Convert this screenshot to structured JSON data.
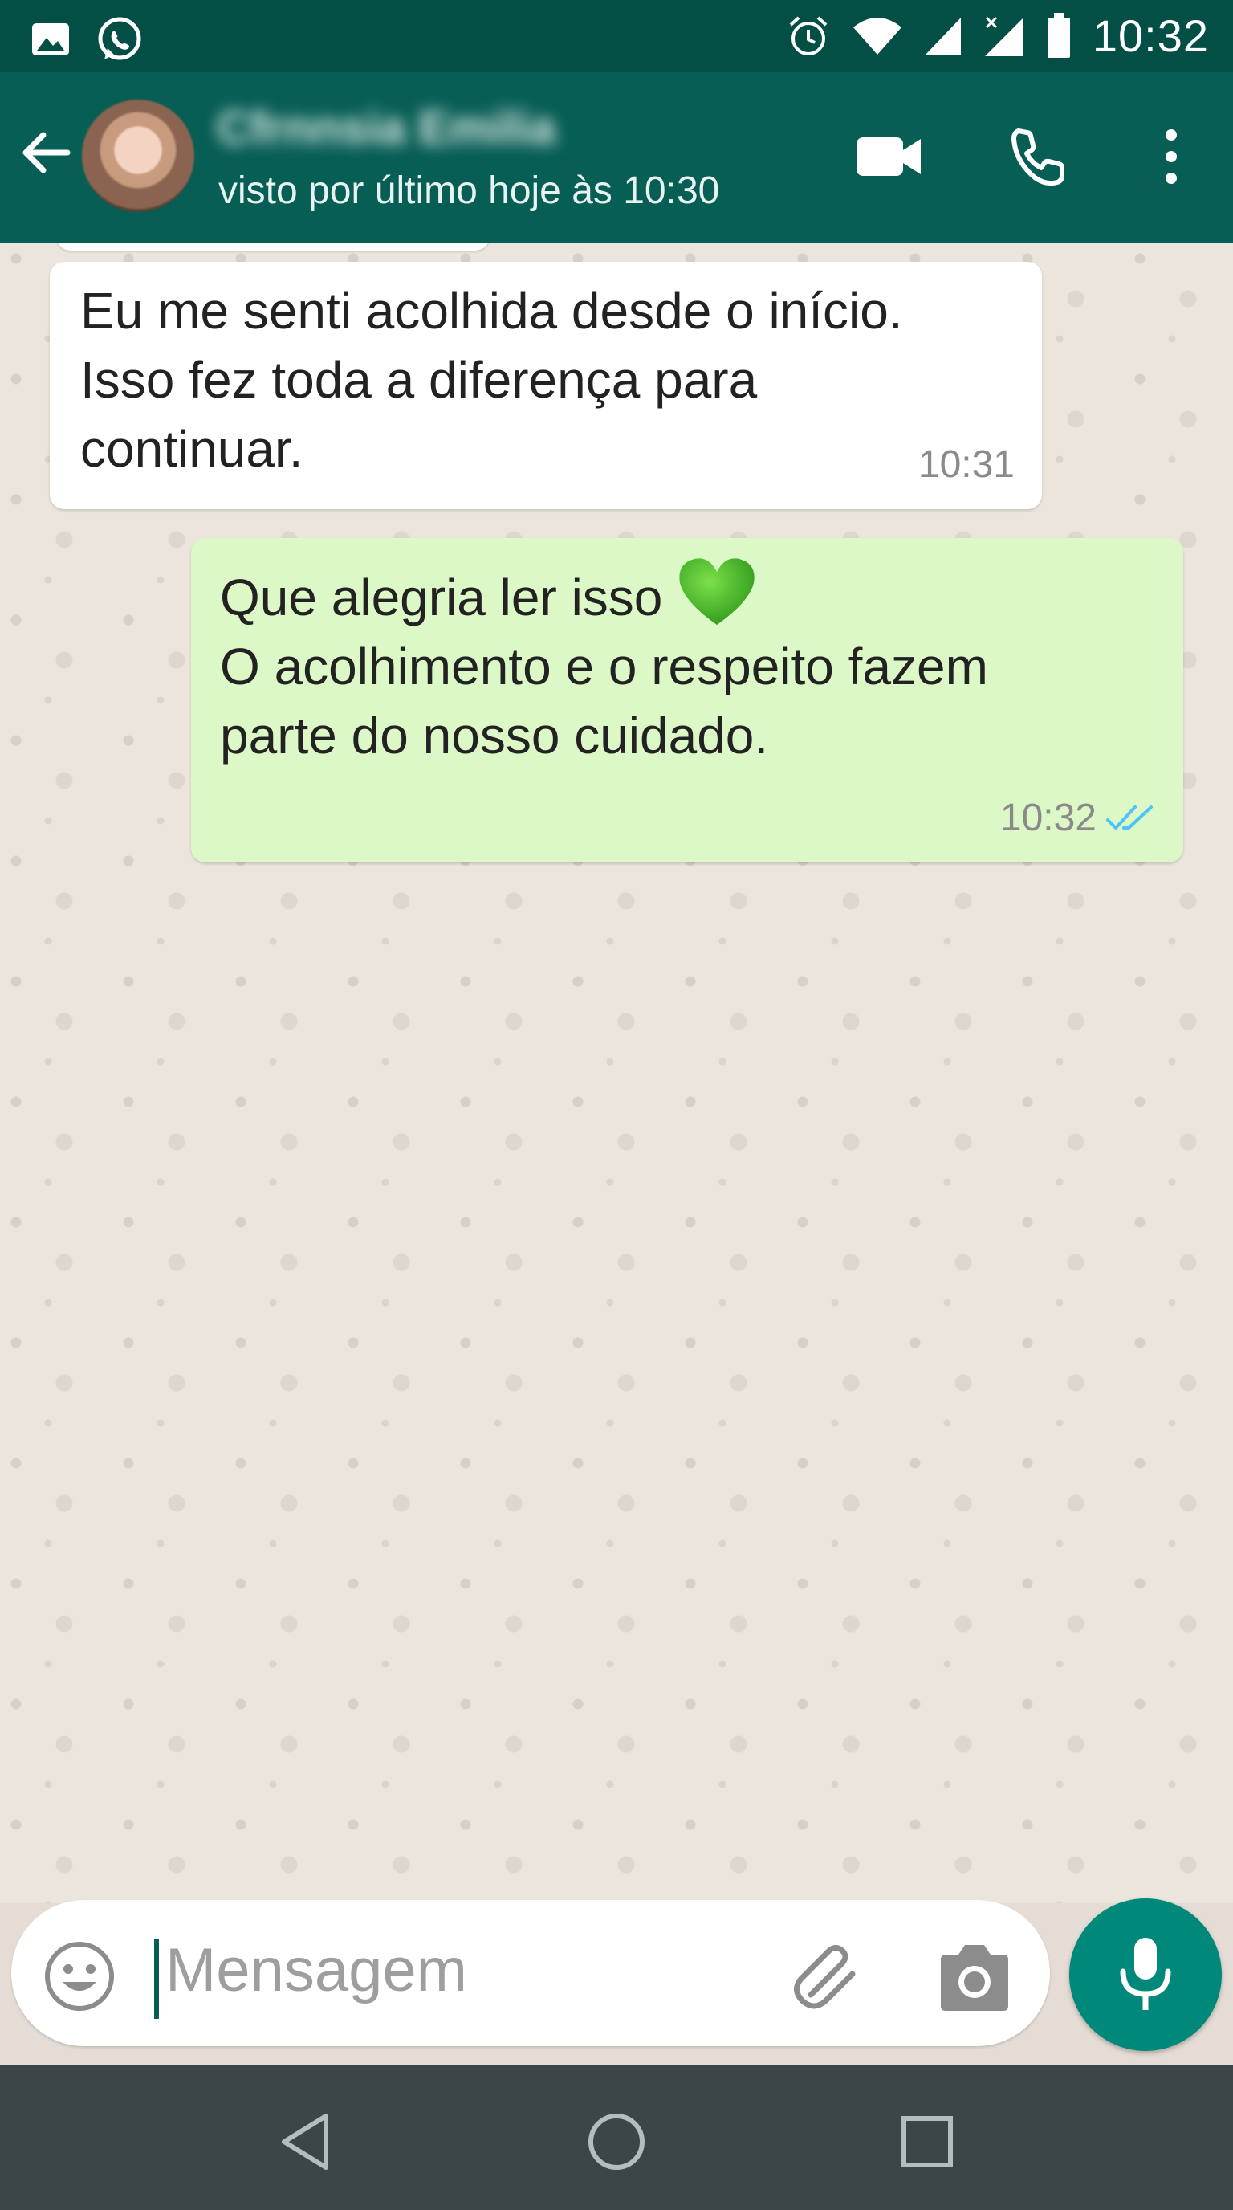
{
  "status_bar": {
    "time": "10:32",
    "left_icons": [
      "gallery-icon",
      "whatsapp-icon"
    ],
    "right_icons": [
      "alarm-icon",
      "wifi-icon",
      "signal-icon",
      "signal-x-icon",
      "battery-icon"
    ]
  },
  "header": {
    "contact_name": "Cfrnnsia Emilia",
    "last_seen": "visto por último hoje às 10:30",
    "actions": [
      "video-call-icon",
      "phone-icon",
      "more-vert-icon"
    ]
  },
  "messages": [
    {
      "direction": "incoming",
      "text": "Eu me senti acolhida desde o início.\nIsso fez toda a diferença para\ncontinuar.",
      "time": "10:31"
    },
    {
      "direction": "outgoing",
      "line1": "Que alegria ler isso",
      "emoji": "green-heart",
      "text": "O acolhimento e o respeito fazem\nparte do nosso cuidado.",
      "time": "10:32",
      "status": "read"
    }
  ],
  "composer": {
    "placeholder": "Mensagem"
  },
  "colors": {
    "header": "#075e54",
    "status_bar": "#044f45",
    "outgoing_bubble": "#dcf8c6",
    "incoming_bubble": "#ffffff",
    "fab": "#00897b",
    "read_ticks": "#4fc3f7"
  }
}
